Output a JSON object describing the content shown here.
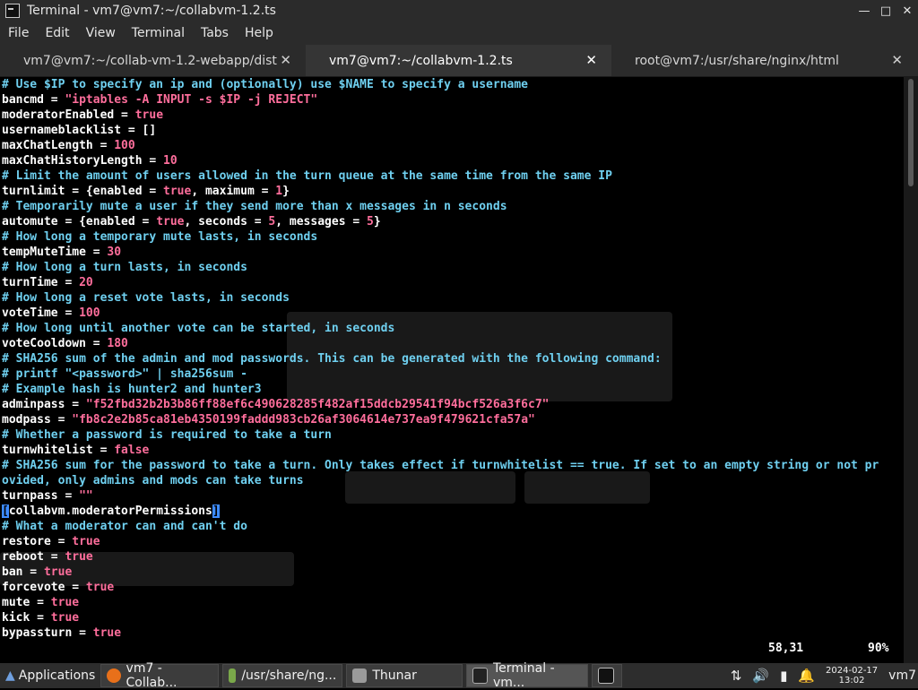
{
  "window": {
    "title": "Terminal - vm7@vm7:~/collabvm-1.2.ts"
  },
  "menu": [
    "File",
    "Edit",
    "View",
    "Terminal",
    "Tabs",
    "Help"
  ],
  "tabs": [
    {
      "label": "vm7@vm7:~/collab-vm-1.2-webapp/dist",
      "active": false
    },
    {
      "label": "vm7@vm7:~/collabvm-1.2.ts",
      "active": true
    },
    {
      "label": "root@vm7:/usr/share/nginx/html",
      "active": false
    }
  ],
  "terminal_lines": [
    [
      [
        "cm",
        "# Use $IP to specify an ip and (optionally) use $NAME to specify a username"
      ]
    ],
    [
      [
        "kw",
        "bancmd = "
      ],
      [
        "st",
        "\"iptables -A INPUT -s $IP -j REJECT\""
      ]
    ],
    [
      [
        "kw",
        "moderatorEnabled = "
      ],
      [
        "nm",
        "true"
      ]
    ],
    [
      [
        "kw",
        "usernameblacklist = []"
      ]
    ],
    [
      [
        "kw",
        "maxChatLength = "
      ],
      [
        "nm",
        "100"
      ]
    ],
    [
      [
        "kw",
        "maxChatHistoryLength = "
      ],
      [
        "nm",
        "10"
      ]
    ],
    [
      [
        "cm",
        "# Limit the amount of users allowed in the turn queue at the same time from the same IP"
      ]
    ],
    [
      [
        "kw",
        "turnlimit = {enabled = "
      ],
      [
        "nm",
        "true"
      ],
      [
        "kw",
        ", maximum = "
      ],
      [
        "nm",
        "1"
      ],
      [
        "kw",
        "}"
      ]
    ],
    [
      [
        "cm",
        "# Temporarily mute a user if they send more than x messages in n seconds"
      ]
    ],
    [
      [
        "kw",
        "automute = {enabled = "
      ],
      [
        "nm",
        "true"
      ],
      [
        "kw",
        ", seconds = "
      ],
      [
        "nm",
        "5"
      ],
      [
        "kw",
        ", messages = "
      ],
      [
        "nm",
        "5"
      ],
      [
        "kw",
        "}"
      ]
    ],
    [
      [
        "cm",
        "# How long a temporary mute lasts, in seconds"
      ]
    ],
    [
      [
        "kw",
        "tempMuteTime = "
      ],
      [
        "nm",
        "30"
      ]
    ],
    [
      [
        "cm",
        "# How long a turn lasts, in seconds"
      ]
    ],
    [
      [
        "kw",
        "turnTime = "
      ],
      [
        "nm",
        "20"
      ]
    ],
    [
      [
        "cm",
        "# How long a reset vote lasts, in seconds"
      ]
    ],
    [
      [
        "kw",
        "voteTime = "
      ],
      [
        "nm",
        "100"
      ]
    ],
    [
      [
        "cm",
        "# How long until another vote can be started, in seconds"
      ]
    ],
    [
      [
        "kw",
        "voteCooldown = "
      ],
      [
        "nm",
        "180"
      ]
    ],
    [
      [
        "cm",
        "# SHA256 sum of the admin and mod passwords. This can be generated with the following command:"
      ]
    ],
    [
      [
        "cm",
        "# printf \"<password>\" | sha256sum -"
      ]
    ],
    [
      [
        "cm",
        "# Example hash is hunter2 and hunter3"
      ]
    ],
    [
      [
        "kw",
        "adminpass = "
      ],
      [
        "st",
        "\"f52fbd32b2b3b86ff88ef6c490628285f482af15ddcb29541f94bcf526a3f6c7\""
      ]
    ],
    [
      [
        "kw",
        "modpass = "
      ],
      [
        "st",
        "\"fb8c2e2b85ca81eb4350199faddd983cb26af3064614e737ea9f479621cfa57a\""
      ]
    ],
    [
      [
        "cm",
        "# Whether a password is required to take a turn"
      ]
    ],
    [
      [
        "kw",
        "turnwhitelist = "
      ],
      [
        "nm",
        "false"
      ]
    ],
    [
      [
        "cm",
        "# SHA256 sum for the password to take a turn. Only takes effect if turnwhitelist == true. If set to an empty string or not pr"
      ]
    ],
    [
      [
        "cm",
        "ovided, only admins and mods can take turns"
      ]
    ],
    [
      [
        "kw",
        "turnpass = "
      ],
      [
        "st",
        "\"\""
      ]
    ],
    [
      [
        "cur",
        "["
      ],
      [
        "kw",
        "collabvm.moderatorPermissions"
      ],
      [
        "cur",
        "]"
      ]
    ],
    [
      [
        "cm",
        "# What a moderator can and can't do"
      ]
    ],
    [
      [
        "kw",
        "restore = "
      ],
      [
        "nm",
        "true"
      ]
    ],
    [
      [
        "kw",
        "reboot = "
      ],
      [
        "nm",
        "true"
      ]
    ],
    [
      [
        "kw",
        "ban = "
      ],
      [
        "nm",
        "true"
      ]
    ],
    [
      [
        "kw",
        "forcevote = "
      ],
      [
        "nm",
        "true"
      ]
    ],
    [
      [
        "kw",
        "mute = "
      ],
      [
        "nm",
        "true"
      ]
    ],
    [
      [
        "kw",
        "kick = "
      ],
      [
        "nm",
        "true"
      ]
    ],
    [
      [
        "kw",
        "bypassturn = "
      ],
      [
        "nm",
        "true"
      ]
    ]
  ],
  "status": {
    "position": "58,31",
    "percent": "90%"
  },
  "taskbar": {
    "applications_label": "Applications",
    "items": [
      {
        "label": "vm7 - Collab...",
        "icon": "firefox-icon",
        "color": "#e8701a"
      },
      {
        "label": "/usr/share/ng...",
        "icon": "editor-icon",
        "color": "#7aa84a"
      },
      {
        "label": "Thunar",
        "icon": "folder-icon",
        "color": "#9a9a9a"
      },
      {
        "label": "Terminal - vm...",
        "icon": "terminal-icon",
        "color": "#222222"
      }
    ],
    "clock_date": "2024-02-17",
    "clock_time": "13:02",
    "user": "vm7"
  }
}
